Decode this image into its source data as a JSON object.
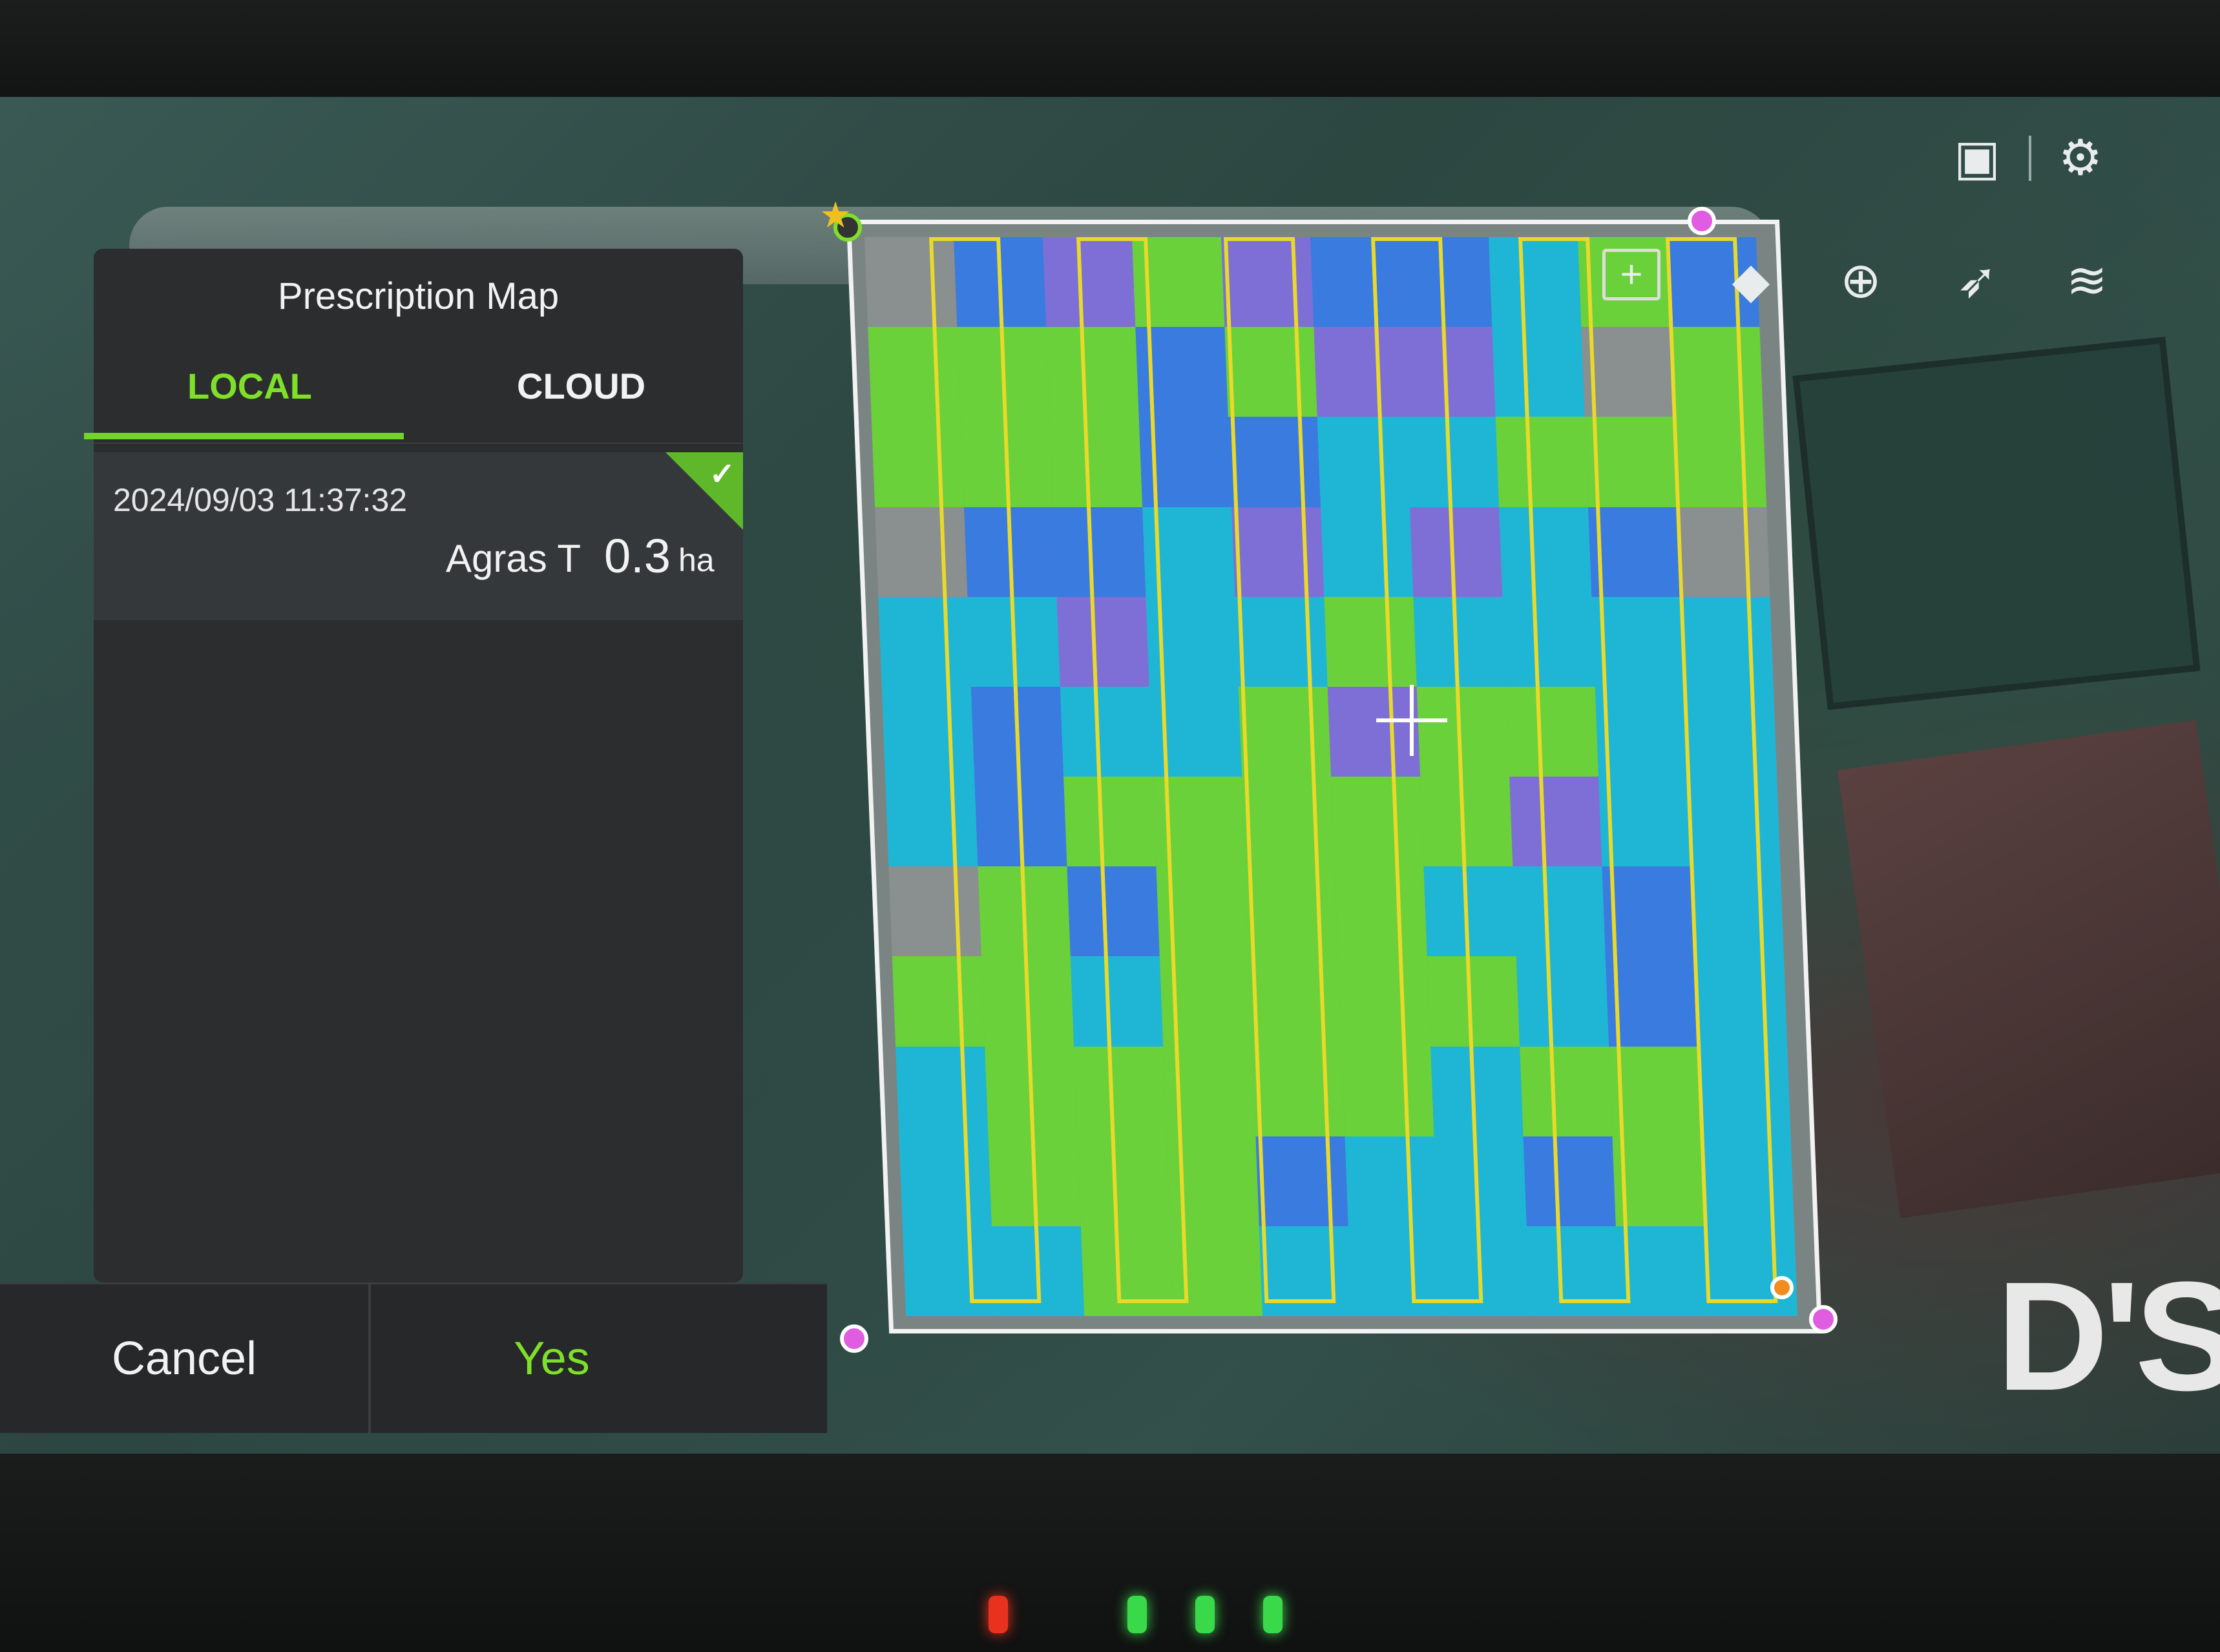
{
  "panel": {
    "title": "Prescription Map",
    "tabs": [
      {
        "label": "LOCAL",
        "active": true
      },
      {
        "label": "CLOUD",
        "active": false
      }
    ],
    "items": [
      {
        "date": "2024/09/03 11:37:32",
        "model": "Agras T",
        "area": "0.3",
        "unit": "ha",
        "selected": true
      }
    ],
    "cancel_label": "Cancel",
    "yes_label": "Yes"
  },
  "map_overlay_text": "D'S",
  "colors": {
    "accent": "#72d428",
    "route": "#e8d92a",
    "boundary": "#f2f2f2",
    "vertex": "#e05ce0",
    "cell_palette": [
      "#3a7be0",
      "#1fb6d6",
      "#6ad13a",
      "#7e6fd6",
      "#8a8f8f"
    ]
  },
  "toolbar_icons": [
    "eraser-icon",
    "drone-add-icon",
    "navigate-arrow-icon",
    "layers-icon",
    "remote-controller-icon",
    "settings-gear-icon",
    "add-folder-icon"
  ],
  "status_leds": [
    "red",
    "green",
    "green",
    "green"
  ]
}
